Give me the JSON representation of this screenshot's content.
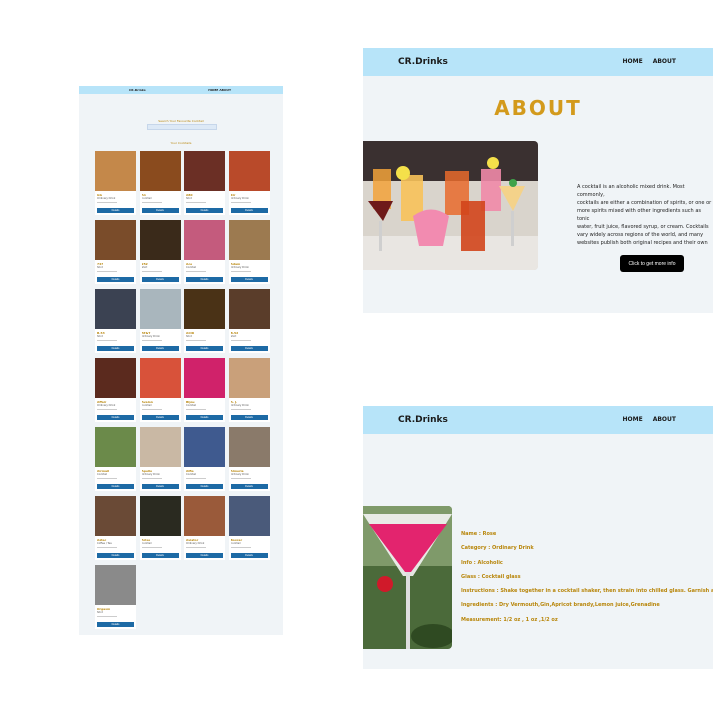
{
  "catalog": {
    "nav": {
      "brand": "CR.Drinks",
      "links": "HOME ABOUT"
    },
    "search_label": "Search Your Favourite Cocktail",
    "count_text": "Your Cocktails",
    "cards": [
      {
        "name": "GG",
        "category": "Ordinary Drink",
        "button": "Details",
        "photo": "#c4884a"
      },
      {
        "name": "A1",
        "category": "Cocktail",
        "button": "Details",
        "photo": "#8a4b1e"
      },
      {
        "name": "ABC",
        "category": "Shot",
        "button": "Details",
        "photo": "#6b2f25"
      },
      {
        "name": "Kir",
        "category": "Ordinary Drink",
        "button": "Details",
        "photo": "#b94a2a"
      },
      {
        "name": "747",
        "category": "Shot",
        "button": "Details",
        "photo": "#7a4c2a"
      },
      {
        "name": "252",
        "category": "Shot",
        "button": "Details",
        "photo": "#3a2a1a"
      },
      {
        "name": "Ace",
        "category": "Cocktail",
        "button": "Details",
        "photo": "#c45b7d"
      },
      {
        "name": "Adam",
        "category": "Ordinary Drink",
        "button": "Details",
        "photo": "#9c7a50"
      },
      {
        "name": "B-53",
        "category": "Shot",
        "button": "Details",
        "photo": "#3b4252"
      },
      {
        "name": "AT&T",
        "category": "Ordinary Drink",
        "button": "Details",
        "photo": "#a9b6bd"
      },
      {
        "name": "ACID",
        "category": "Shot",
        "button": "Details",
        "photo": "#4a3216"
      },
      {
        "name": "B-52",
        "category": "Shot",
        "button": "Details",
        "photo": "#5a3d2a"
      },
      {
        "name": "Affair",
        "category": "Ordinary Drink",
        "button": "Details",
        "photo": "#5b2a1e"
      },
      {
        "name": "Avalon",
        "category": "Cocktail",
        "button": "Details",
        "photo": "#d8523a"
      },
      {
        "name": "Bijou",
        "category": "Cocktail",
        "button": "Details",
        "photo": "#d0226a"
      },
      {
        "name": "A. J.",
        "category": "Ordinary Drink",
        "button": "Details",
        "photo": "#c9a07a"
      },
      {
        "name": "Airmail",
        "category": "Cocktail",
        "button": "Details",
        "photo": "#6b8a4a"
      },
      {
        "name": "Apello",
        "category": "Ordinary Drink",
        "button": "Details",
        "photo": "#c9b8a4"
      },
      {
        "name": "Alfie",
        "category": "Cocktail",
        "button": "Details",
        "photo": "#3f5a8f"
      },
      {
        "name": "Almeria",
        "category": "Ordinary Drink",
        "button": "Details",
        "photo": "#8a7a6a"
      },
      {
        "name": "Aztec",
        "category": "Coffee / Tea",
        "button": "Details",
        "photo": "#6a4a36"
      },
      {
        "name": "Arise",
        "category": "Cocktail",
        "button": "Details",
        "photo": "#2a2a20"
      },
      {
        "name": "Aviator",
        "category": "Ordinary Drink",
        "button": "Details",
        "photo": "#9a5a3a"
      },
      {
        "name": "Boxcar",
        "category": "Cocktail",
        "button": "Details",
        "photo": "#4a5a7a"
      },
      {
        "name": "Orgasm",
        "category": "Shot",
        "button": "Details",
        "photo": "#8a8a8a"
      }
    ]
  },
  "about": {
    "nav": {
      "brand": "CR.Drinks",
      "home": "HOME",
      "about": "ABOUT"
    },
    "title": "ABOUT",
    "description": "A cocktail is an alcoholic mixed drink. Most commonly,\ncocktails are either a combination of spirits, or one or\nmore spirits mixed with other ingredients such as tonic\nwater, fruit juice, flavored syrup, or cream. Cocktails\nvary widely across regions of the world, and many\nwebsites publish both original recipes and their own\ninterpretations of older and more famous cocktails.",
    "cta_label": "Click to get more info"
  },
  "detail": {
    "nav": {
      "brand": "CR.Drinks",
      "home": "HOME",
      "about": "ABOUT"
    },
    "name": "Name : Rose",
    "category": "Category : Ordinary Drink",
    "info": "Info : Alcoholic",
    "glass": "Glass : Cocktail glass",
    "instructions": "Instructions : Shake together in a cocktail shaker, then strain into chilled glass. Garnish and serve.",
    "ingredients": "Ingredients : Dry Vermouth,Gin,Apricot brandy,Lemon juice,Grenadine",
    "measurement": "Measurement: 1/2 oz , 1 oz ,1/2 oz"
  }
}
